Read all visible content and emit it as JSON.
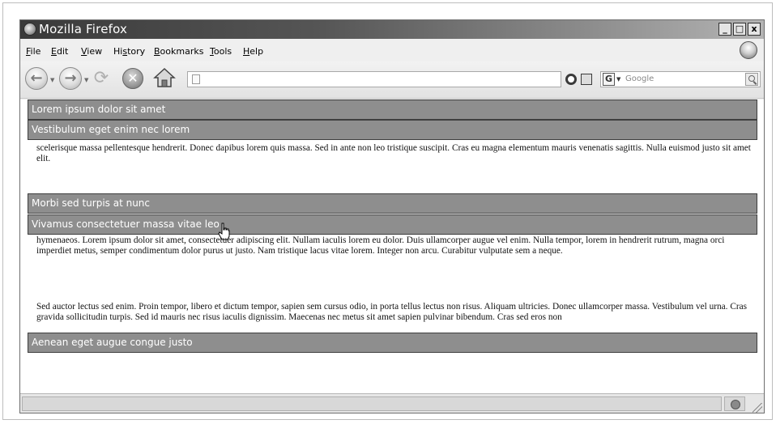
{
  "window": {
    "title": "Mozilla Firefox",
    "controls": {
      "minimize": "_",
      "maximize": "□",
      "close": "x"
    }
  },
  "menu": {
    "items": [
      {
        "key": "F",
        "rest": "ile"
      },
      {
        "key": "E",
        "rest": "dit"
      },
      {
        "key": "V",
        "rest": "iew"
      },
      {
        "pre": "Hi",
        "key": "s",
        "rest": "tory"
      },
      {
        "key": "B",
        "rest": "ookmarks"
      },
      {
        "key": "T",
        "rest": "ools"
      },
      {
        "key": "H",
        "rest": "elp"
      }
    ]
  },
  "navigation": {
    "back_glyph": "←",
    "forward_glyph": "→",
    "reload_glyph": "⟳",
    "stop_glyph": "✕",
    "url_value": "",
    "search": {
      "engine_glyph": "G",
      "placeholder": "Google"
    }
  },
  "accordion": {
    "sections": [
      {
        "header": "Lorem ipsum dolor sit amet",
        "state": "collapsed"
      },
      {
        "header": "Vestibulum eget enim nec lorem",
        "state": "expanded",
        "body": [
          "scelerisque massa pellentesque hendrerit. Donec dapibus lorem quis massa. Sed in ante non leo tristique suscipit. Cras eu magna elementum mauris venenatis sagittis. Nulla euismod justo sit amet elit."
        ]
      },
      {
        "header": "Morbi sed turpis at nunc",
        "state": "collapsed"
      },
      {
        "header": "Vivamus consectetuer massa vitae leo",
        "state": "expanded",
        "hovered": true,
        "body": [
          "hymenaeos. Lorem ipsum dolor sit amet, consectetuer adipiscing elit. Nullam iaculis lorem eu dolor. Duis ullamcorper augue vel enim. Nulla tempor, lorem in hendrerit rutrum, magna orci imperdiet metus, semper condimentum dolor purus ut justo. Nam tristique lacus vitae lorem. Integer non arcu. Curabitur vulputate sem a neque.",
          "Sed auctor lectus sed enim. Proin tempor, libero et dictum tempor, sapien sem cursus odio, in porta tellus lectus non risus. Aliquam ultricies. Donec ullamcorper massa. Vestibulum vel urna. Cras gravida sollicitudin turpis. Sed id mauris nec risus iaculis dignissim. Maecenas nec metus sit amet sapien pulvinar bibendum. Cras sed eros non"
        ]
      },
      {
        "header": "Aenean eget augue congue justo",
        "state": "collapsed"
      }
    ]
  },
  "statusbar": {
    "text": ""
  },
  "colors": {
    "header_bg": "#8e8e8e",
    "header_text": "#ffffff",
    "titlebar_dark": "#3a3a3a"
  }
}
